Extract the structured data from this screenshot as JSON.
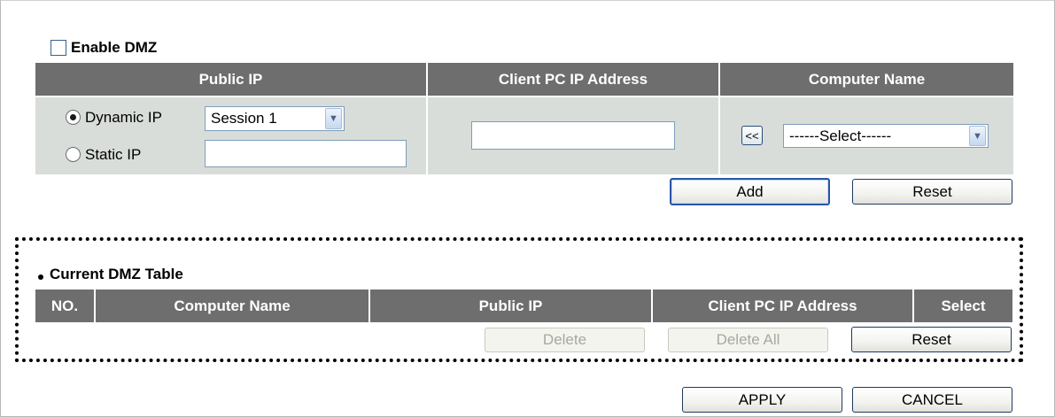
{
  "dmz": {
    "enable_label": "Enable DMZ",
    "enabled": false
  },
  "config_table": {
    "headers": {
      "public_ip": "Public IP",
      "client_ip": "Client PC IP Address",
      "computer_name": "Computer Name"
    },
    "dynamic_ip_label": "Dynamic IP",
    "static_ip_label": "Static IP",
    "selected_mode": "Dynamic IP",
    "session_select_value": "Session 1",
    "static_ip_value": "",
    "client_ip_value": "",
    "copy_button_label": "<<",
    "computer_select_value": "------Select------"
  },
  "config_buttons": {
    "add": "Add",
    "reset": "Reset"
  },
  "current_table": {
    "title": "Current DMZ Table",
    "headers": {
      "no": "NO.",
      "computer_name": "Computer Name",
      "public_ip": "Public IP",
      "client_ip": "Client PC IP Address",
      "select": "Select"
    },
    "rows": [],
    "buttons": {
      "delete": "Delete",
      "delete_all": "Delete All",
      "reset": "Reset"
    }
  },
  "footer": {
    "apply": "APPLY",
    "cancel": "CANCEL"
  }
}
